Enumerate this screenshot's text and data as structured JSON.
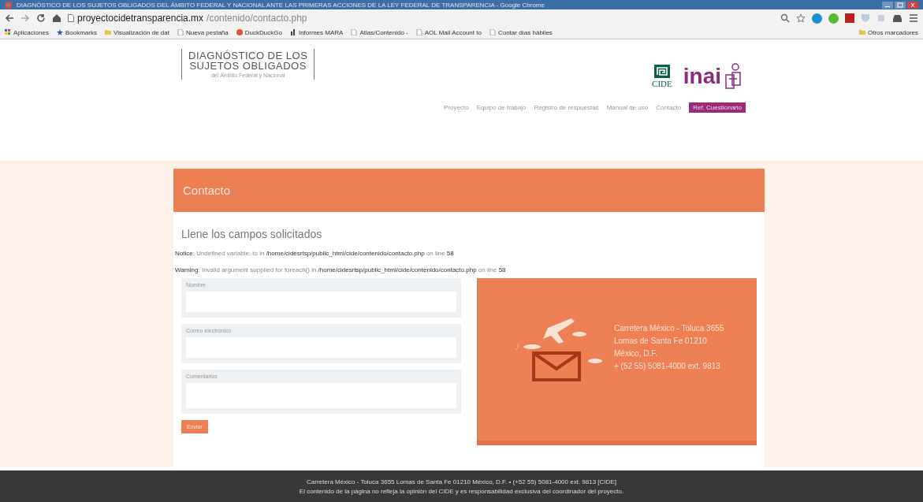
{
  "window": {
    "title": "DIAGNÓSTICO DE LOS SUJETOS OBLIGADOS DEL ÁMBITO FEDERAL Y NACIONAL ANTE LAS PRIMERAS ACCIONES DE LA LEY FEDERAL DE TRANSPARENCIA - Google Chrome"
  },
  "browser": {
    "url_host": "proyectocidetransparencia.mx",
    "url_path": "/contenido/contacto.php",
    "bookmarks": [
      {
        "label": "Aplicaciones",
        "kind": "apps"
      },
      {
        "label": "Bookmarks",
        "kind": "star"
      },
      {
        "label": "Visualización de dat",
        "kind": "folder"
      },
      {
        "label": "Nueva pestaña",
        "kind": "page"
      },
      {
        "label": "DuckDuckGo",
        "kind": "duck"
      },
      {
        "label": "Informes MARA",
        "kind": "chart"
      },
      {
        "label": "Atlas/Contenido -",
        "kind": "page"
      },
      {
        "label": "AOL Mail Account to",
        "kind": "page"
      },
      {
        "label": "Contar días hábiles",
        "kind": "page"
      }
    ],
    "other_bookmarks": "Otros marcadores"
  },
  "site": {
    "logo_line_1": "DIAGNÓSTICO DE LOS",
    "logo_line_2": "SUJETOS OBLIGADOS",
    "logo_tagline": "del Ámbito Federal y Nacional",
    "cide_label": "CIDE",
    "inai_label": "inai",
    "nav": [
      {
        "label": "Proyecto",
        "kind": "link"
      },
      {
        "label": "Equipo de trabajo",
        "kind": "link"
      },
      {
        "label": "Registro de respuestas",
        "kind": "link"
      },
      {
        "label": "Manual de uso",
        "kind": "link"
      },
      {
        "label": "Contacto",
        "kind": "link"
      },
      {
        "label": "Ref. Cuestionario",
        "kind": "button"
      }
    ]
  },
  "contact": {
    "heading": "Contacto",
    "subheading": "Llene los campos solicitados",
    "messages": [
      "**Notice**: Undefined variable: to in **/home/cidesrtsp/public_html/cide/contenido/contacto.php** on line **58**",
      "**Warning**: Invalid argument supplied for foreach() in **/home/cidesrtsp/public_html/cide/contenido/contacto.php** on line **58**"
    ],
    "fields": [
      {
        "label": "Nombre",
        "kind": "input"
      },
      {
        "label": "Correo electrónico",
        "kind": "input"
      },
      {
        "label": "Comentarios",
        "kind": "textarea"
      }
    ],
    "submit": "Enviar",
    "address": [
      "Carretera México - Toluca 3655",
      "Lomas de Santa Fe 01210",
      "México, D.F.",
      "+ (52 55) 5081-4000 ext. 9813"
    ]
  },
  "footer": {
    "lines": [
      "Carretera México - Toluca 3655 Lomas de Santa Fe 01210 México, D.F. • (+52 55) 5081-4000 ext. 9813 [CIDE]",
      "El contenido de la página no refleja la opinión del CIDE y es responsabilidad exclusiva del coordinador del proyecto."
    ]
  }
}
